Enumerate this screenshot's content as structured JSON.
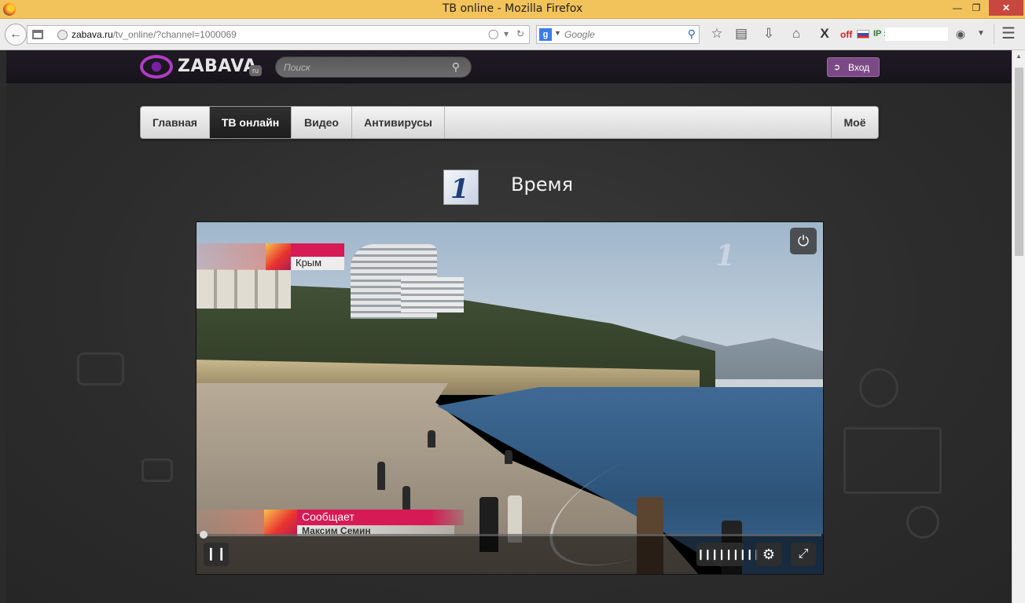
{
  "window": {
    "title": "ТВ online - Mozilla Firefox",
    "minimize": "—",
    "maximize": "❐",
    "close": "✕"
  },
  "toolbar": {
    "url_host": "zabava.ru",
    "url_path": "/tv_online/?channel=1000069",
    "search_placeholder": "Google",
    "off_label": "off",
    "ip_label": "IP :"
  },
  "site": {
    "logo": "ZABAVA",
    "logo_suffix": "ru",
    "search_placeholder": "Поиск",
    "login_label": "Вход"
  },
  "menu": {
    "items": [
      {
        "label": "Главная"
      },
      {
        "label": "ТВ онлайн"
      },
      {
        "label": "Видео"
      },
      {
        "label": "Антивирусы"
      }
    ],
    "right_item": "Моё"
  },
  "channel": {
    "title": "Время",
    "logo_glyph": "1"
  },
  "video": {
    "caption_location": "Крым",
    "caption_source": "Сообщает",
    "caption_name": "Максим Семин",
    "progress": 0.0
  },
  "icons": {
    "back": "arrow-left-icon",
    "power": "power-icon",
    "pause": "pause-icon",
    "volume": "volume-bars-icon",
    "settings": "gear-icon",
    "fullscreen": "fullscreen-icon"
  },
  "colors": {
    "titlebar": "#f3c35b",
    "accent": "#7b4a86",
    "caption_red": "#d61a55"
  }
}
